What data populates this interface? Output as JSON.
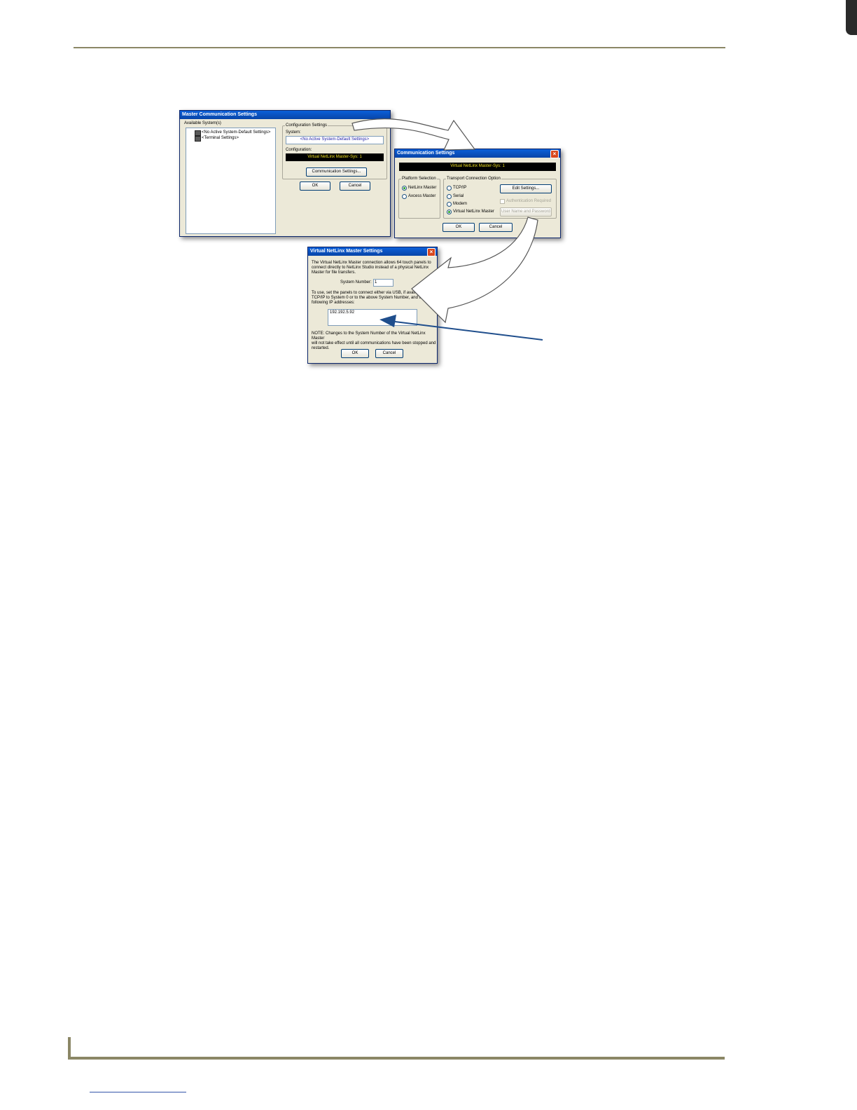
{
  "dialog_master": {
    "title": "Master Communication Settings",
    "available_systems_label": "Available System(s)",
    "tree_items": [
      "<No Active System-Default Settings>",
      "<Terminal Settings>"
    ],
    "config_settings_label": "Configuration Settings",
    "system_label": "System:",
    "system_value": "<No Active System-Default Settings>",
    "configuration_label": "Configuration:",
    "configuration_value": "Virtual NetLinx Master-Sys: 1",
    "comm_settings_button": "Communication Settings...",
    "ok_button": "OK",
    "cancel_button": "Cancel"
  },
  "dialog_comm": {
    "title": "Communication Settings",
    "status_value": "Virtual NetLinx Master-Sys: 1",
    "platform_group": "Platform Selection",
    "platform_options": [
      "NetLinx Master",
      "Axcess Master"
    ],
    "transport_group": "Transport Connection Option",
    "transport_options": [
      "TCP/IP",
      "Serial",
      "Modem",
      "Virtual NetLinx Master"
    ],
    "edit_settings_button": "Edit Settings...",
    "auth_checkbox_label": "Authentication Required",
    "user_password_button": "User Name and Password",
    "ok_button": "OK",
    "cancel_button": "Cancel"
  },
  "dialog_vnm": {
    "title": "Virtual NetLinx Master Settings",
    "intro_lines": [
      "The Virtual NetLinx Master connection allows 64 touch panels to",
      "connect directly to NetLinx Studio instead of a physical NetLinx",
      "Master for file transfers."
    ],
    "system_number_label": "System Number:",
    "system_number_value": "1",
    "usage_lines": [
      "To use, set the panels to connect either via USB, if avail",
      "TCP/IP to System 0 or to the above System Number, and any",
      "following IP addresses:"
    ],
    "ip_address": "192.192.5.92",
    "note_lines": [
      "NOTE: Changes to the System Number of the Virtual NetLinx Master",
      "will not take effect until all communications have been stopped and",
      "restarted."
    ],
    "ok_button": "OK",
    "cancel_button": "Cancel"
  },
  "colors": {
    "rule": "#8b8766",
    "titlebar": "#0845a8",
    "dialog_bg": "#ece9d8",
    "annotation_arrow": "#1f4e8c"
  }
}
